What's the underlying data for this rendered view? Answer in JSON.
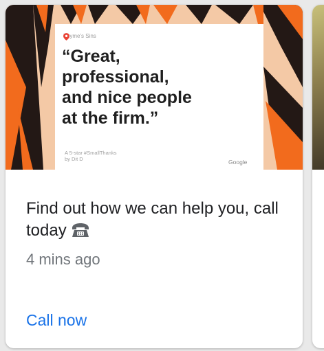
{
  "post": {
    "place_name": "Thyme's Sins",
    "quote": "“Great,\nprofessional,\nand nice people\nat the firm.”",
    "thanks": "A 5-star #SmallThanks\nby Dit D",
    "brand": "Google",
    "description": "Find out how we can help you, call today",
    "time_ago": "4 mins ago",
    "cta_label": "Call now"
  },
  "icons": {
    "pin": "map-pin-icon",
    "phone": "telephone-icon"
  },
  "colors": {
    "accent": "#1a73e8",
    "pin": "#ea4335",
    "hero_orange": "#f26b1d",
    "hero_dark": "#231815",
    "hero_skin": "#f4c9a6"
  }
}
